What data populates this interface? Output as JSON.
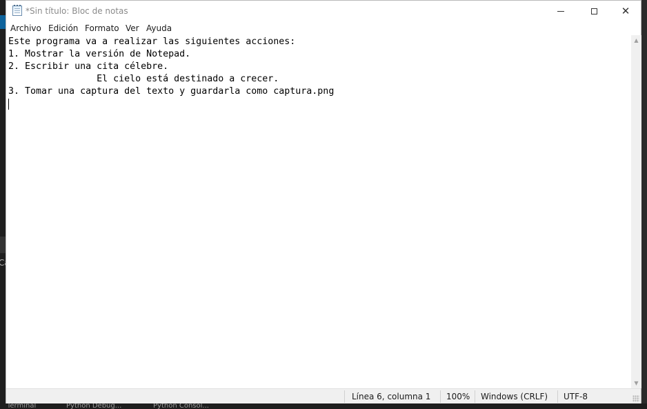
{
  "window": {
    "title": "*Sin título: Bloc de notas"
  },
  "menu": [
    "Archivo",
    "Edición",
    "Formato",
    "Ver",
    "Ayuda"
  ],
  "editor": {
    "lines": [
      "Este programa va a realizar las siguientes acciones:",
      "1. Mostrar la versión de Notepad.",
      "2. Escribir una cita célebre.",
      "                El cielo está destinado a crecer.",
      "3. Tomar una captura del texto y guardarla como captura.png",
      ""
    ]
  },
  "status": {
    "position": "Línea 6, columna 1",
    "zoom": "100%",
    "line_ending": "Windows (CRLF)",
    "encoding": "UTF-8"
  },
  "background": {
    "fragment": "Ca",
    "taskbar": [
      "Terminal",
      "Python Debug...",
      "Python Consol..."
    ]
  },
  "icons": {
    "app": "notepad-icon",
    "minimize": "minimize-icon",
    "maximize": "maximize-icon",
    "close": "close-icon",
    "scroll_up": "scroll-up-arrow-icon",
    "scroll_down": "scroll-down-arrow-icon",
    "grip": "resize-grip-icon"
  },
  "colors": {
    "editor_bg": "#ffffff",
    "chrome_bg": "#f0f0f0",
    "text": "#000000",
    "title_text": "#8a8a8a"
  }
}
